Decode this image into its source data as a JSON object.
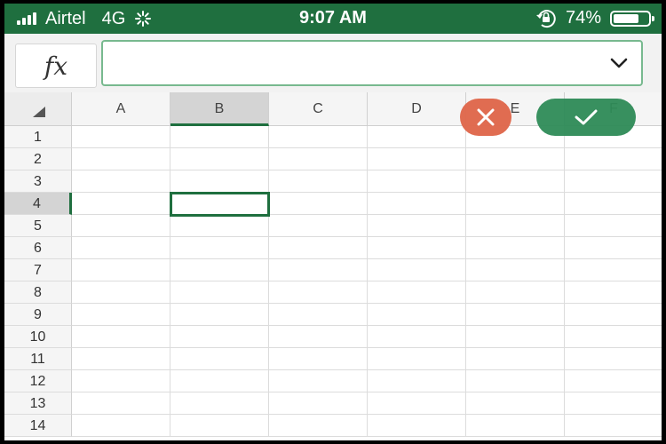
{
  "status": {
    "carrier": "Airtel",
    "network": "4G",
    "time": "9:07 AM",
    "battery": "74%",
    "battery_level": 0.74
  },
  "formula_bar": {
    "fx_label": "fx",
    "value": "",
    "expand_icon": "chevron-down-icon"
  },
  "columns": [
    "A",
    "B",
    "C",
    "D",
    "E",
    "F"
  ],
  "rows": [
    "1",
    "2",
    "3",
    "4",
    "5",
    "6",
    "7",
    "8",
    "9",
    "10",
    "11",
    "12",
    "13",
    "14"
  ],
  "selection": {
    "column": "B",
    "row": "4"
  },
  "actions": {
    "cancel_icon": "close-icon",
    "accept_icon": "checkmark-icon"
  },
  "colors": {
    "accent": "#1f6f3f",
    "cancel": "#e0684c",
    "accept": "#2e8b57"
  }
}
